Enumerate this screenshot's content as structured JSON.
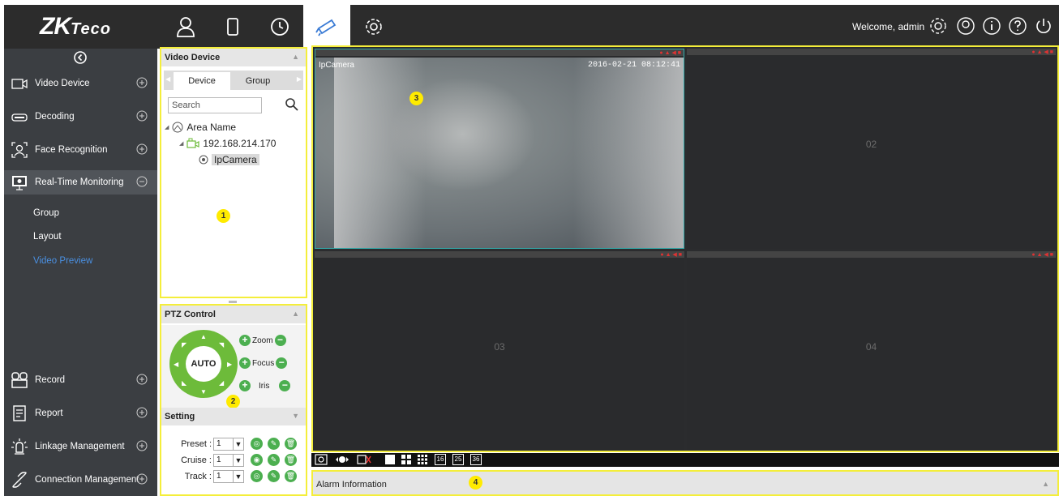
{
  "app": {
    "logo_main": "ZK",
    "logo_sub": "Teco"
  },
  "topbar": {
    "nav": [
      {
        "icon": "person-icon"
      },
      {
        "icon": "door-icon"
      },
      {
        "icon": "clock-icon"
      },
      {
        "icon": "camera-icon",
        "active": true
      },
      {
        "icon": "gear-icon"
      }
    ],
    "welcome": "Welcome, admin",
    "right_icons": [
      "settings-icon",
      "user-icon",
      "info-icon",
      "help-icon",
      "power-icon"
    ]
  },
  "sidebar": {
    "items": [
      {
        "label": "Video Device",
        "icon": "video-device-icon",
        "expand": "+"
      },
      {
        "label": "Decoding",
        "icon": "decoding-icon",
        "expand": "+"
      },
      {
        "label": "Face Recognition",
        "icon": "face-recognition-icon",
        "expand": "+"
      },
      {
        "label": "Real-Time Monitoring",
        "icon": "monitor-icon",
        "expand": "−"
      },
      {
        "label": "Record",
        "icon": "record-icon",
        "expand": "+"
      },
      {
        "label": "Report",
        "icon": "report-icon",
        "expand": "+"
      },
      {
        "label": "Linkage Management",
        "icon": "linkage-icon",
        "expand": "+"
      },
      {
        "label": "Connection Management",
        "icon": "connection-icon",
        "expand": "+"
      }
    ],
    "subitems": [
      "Group",
      "Layout",
      "Video Preview"
    ]
  },
  "video_device_panel": {
    "title": "Video Device",
    "tabs": [
      "Device",
      "Group"
    ],
    "search_placeholder": "Search",
    "tree": {
      "area": "Area Name",
      "ip": "192.168.214.170",
      "camera": "IpCamera"
    },
    "badge": "1"
  },
  "ptz_panel": {
    "title": "PTZ Control",
    "dial_label": "AUTO",
    "controls": [
      "Zoom",
      "Focus",
      "Iris"
    ],
    "badge": "2"
  },
  "setting_panel": {
    "title": "Setting",
    "rows": [
      {
        "label": "Preset :",
        "value": "1"
      },
      {
        "label": "Cruise :",
        "value": "1"
      },
      {
        "label": "Track :",
        "value": "1"
      }
    ]
  },
  "video_grid": {
    "badge": "3",
    "tile1": {
      "camera_label": "IpCamera",
      "timestamp": "2016-02-21 08:12:41"
    },
    "tiles": [
      "02",
      "03",
      "04"
    ]
  },
  "toolbar": {
    "layout_labels": [
      "16",
      "25",
      "36"
    ]
  },
  "alarm": {
    "label": "Alarm Information",
    "badge": "4"
  },
  "colors": {
    "highlight": "#f4ee3a",
    "accent_green": "#6dbb3a",
    "link_blue": "#4a90e2"
  }
}
